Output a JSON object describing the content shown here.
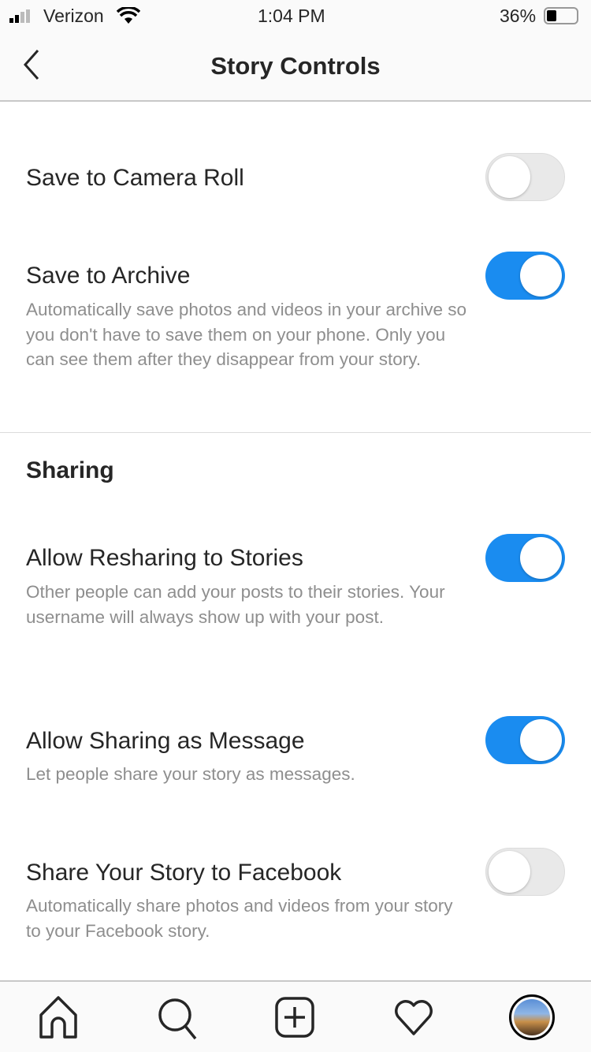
{
  "status_bar": {
    "carrier": "Verizon",
    "time": "1:04 PM",
    "battery": "36%",
    "battery_level": 0.36
  },
  "nav": {
    "title": "Story Controls",
    "back_icon": "chevron-left-icon"
  },
  "saving": {
    "camera_roll": {
      "label": "Save to Camera Roll",
      "enabled": false
    },
    "archive": {
      "label": "Save to Archive",
      "description": "Automatically save photos and videos in your archive so you don't have to save them on your phone. Only you can see them after they disappear from your story.",
      "enabled": true
    }
  },
  "sharing": {
    "heading": "Sharing",
    "resharing": {
      "label": "Allow Resharing to Stories",
      "description": "Other people can add your posts to their stories. Your username will always show up with your post.",
      "enabled": true
    },
    "message": {
      "label": "Allow Sharing as Message",
      "description": "Let people share your story as messages.",
      "enabled": true
    },
    "facebook": {
      "label": "Share Your Story to Facebook",
      "description": "Automatically share photos and videos from your story to your Facebook story.",
      "enabled": false
    }
  },
  "tabbar": {
    "icons": [
      "home-icon",
      "search-icon",
      "new-post-icon",
      "heart-icon",
      "profile-avatar"
    ]
  },
  "colors": {
    "accent": "#1a8cf0",
    "text": "#262626",
    "secondary": "#8e8e8e"
  }
}
